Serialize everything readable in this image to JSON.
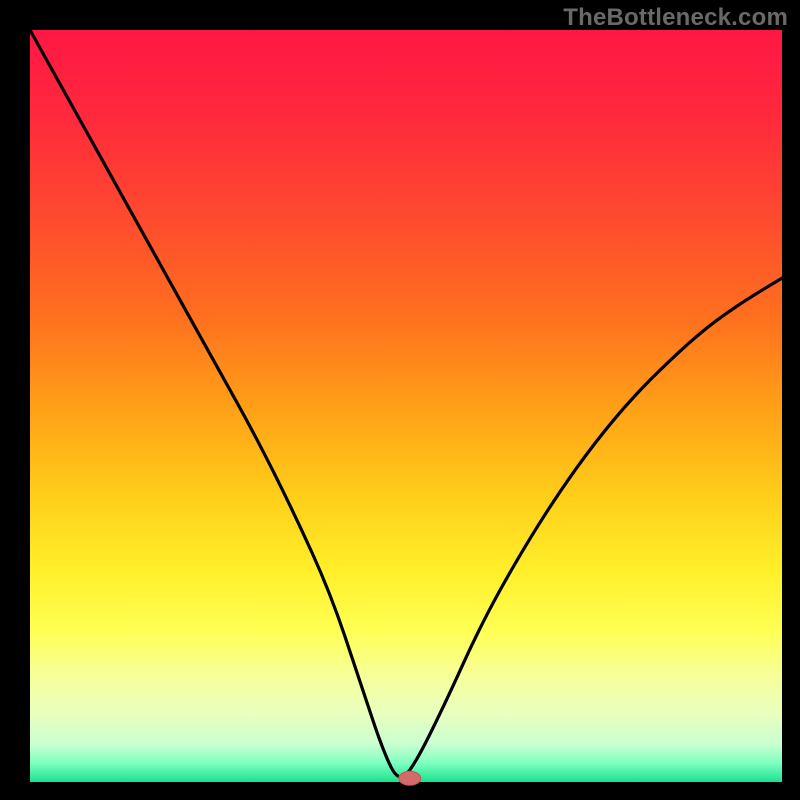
{
  "watermark": "TheBottleneck.com",
  "colors": {
    "frame": "#000000",
    "curve": "#000000",
    "marker_fill": "#d46a6a",
    "marker_stroke": "#c25b5b",
    "gradient_stops": [
      {
        "offset": 0.0,
        "color": "#ff1744"
      },
      {
        "offset": 0.12,
        "color": "#ff2a3c"
      },
      {
        "offset": 0.25,
        "color": "#ff4a2e"
      },
      {
        "offset": 0.38,
        "color": "#ff6f1f"
      },
      {
        "offset": 0.5,
        "color": "#ff9f17"
      },
      {
        "offset": 0.62,
        "color": "#ffce1a"
      },
      {
        "offset": 0.72,
        "color": "#fff02a"
      },
      {
        "offset": 0.8,
        "color": "#ffff55"
      },
      {
        "offset": 0.86,
        "color": "#f6ff9a"
      },
      {
        "offset": 0.91,
        "color": "#e8ffc0"
      },
      {
        "offset": 0.95,
        "color": "#c9ffd0"
      },
      {
        "offset": 0.975,
        "color": "#7dffc0"
      },
      {
        "offset": 1.0,
        "color": "#19e28f"
      }
    ]
  },
  "chart_data": {
    "type": "line",
    "title": "",
    "xlabel": "",
    "ylabel": "",
    "xlim": [
      0,
      100
    ],
    "ylim": [
      0,
      100
    ],
    "grid": false,
    "legend": false,
    "optimum": {
      "x": 49,
      "y": 0
    },
    "marker": {
      "x": 50.5,
      "y": 0.5
    },
    "series": [
      {
        "name": "bottleneck-curve",
        "x": [
          0,
          5,
          10,
          15,
          20,
          25,
          30,
          35,
          40,
          44,
          47,
          49,
          51,
          55,
          60,
          65,
          70,
          75,
          80,
          85,
          90,
          95,
          100
        ],
        "y": [
          100,
          91,
          82,
          73,
          64,
          55,
          46,
          36,
          25,
          13,
          4,
          0,
          2,
          10,
          21,
          30,
          38,
          45,
          51,
          56,
          60.5,
          64,
          67
        ]
      }
    ]
  }
}
